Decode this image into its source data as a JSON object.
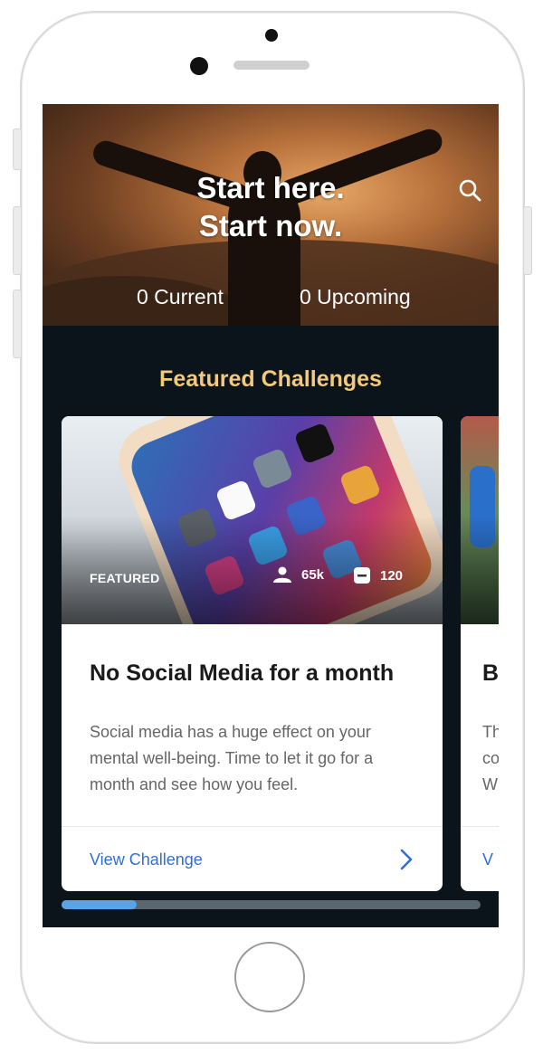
{
  "hero": {
    "title_line1": "Start here.",
    "title_line2": "Start now.",
    "current_label": "0 Current",
    "upcoming_label": "0 Upcoming",
    "search_icon": "search-icon"
  },
  "featured": {
    "section_title": "Featured Challenges",
    "cards": [
      {
        "tag": "FEATURED",
        "participants": "65k",
        "posts": "120",
        "title": "No Social Media for a month",
        "description": "Social media has a huge effect on your mental well-being.  Time to let it go for a month and see how you feel.",
        "link_label": "View Challenge"
      },
      {
        "title": "B",
        "description_lines": [
          "Th",
          "co",
          "W"
        ],
        "link_label": "V"
      }
    ],
    "scroll_progress": 0.18
  },
  "colors": {
    "accent_title": "#f4c97a",
    "link": "#2f6fd8",
    "screen_bg": "#0b141b",
    "scroll_thumb": "#5aa3e6"
  }
}
